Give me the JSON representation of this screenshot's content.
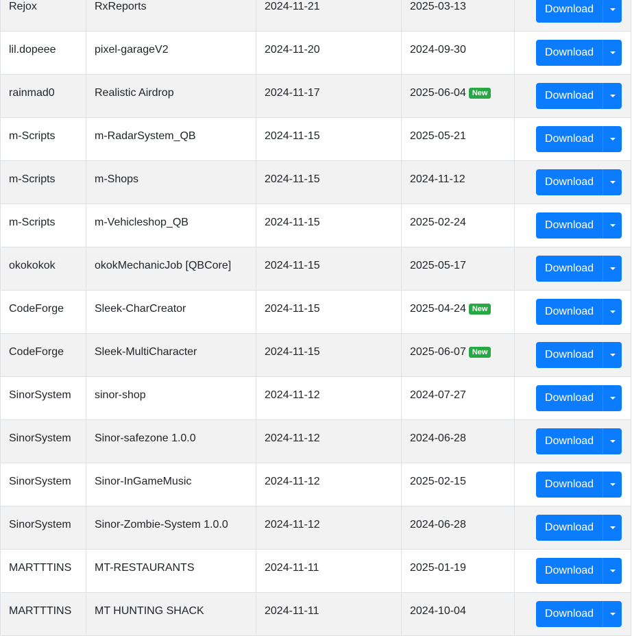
{
  "button": {
    "label": "Download"
  },
  "rows": [
    {
      "author": "Rejox",
      "name": "RxReports",
      "added": "2024-11-21",
      "updated": "2025-03-13",
      "badge": ""
    },
    {
      "author": "lil.dopeee",
      "name": "pixel-garageV2",
      "added": "2024-11-20",
      "updated": "2024-09-30",
      "badge": ""
    },
    {
      "author": "rainmad0",
      "name": "Realistic Airdrop",
      "added": "2024-11-17",
      "updated": "2025-06-04",
      "badge": "New"
    },
    {
      "author": "m-Scripts",
      "name": "m-RadarSystem_QB",
      "added": "2024-11-15",
      "updated": "2025-05-21",
      "badge": ""
    },
    {
      "author": "m-Scripts",
      "name": "m-Shops",
      "added": "2024-11-15",
      "updated": "2024-11-12",
      "badge": ""
    },
    {
      "author": "m-Scripts",
      "name": "m-Vehicleshop_QB",
      "added": "2024-11-15",
      "updated": "2025-02-24",
      "badge": ""
    },
    {
      "author": "okokokok",
      "name": "okokMechanicJob [QBCore]",
      "added": "2024-11-15",
      "updated": "2025-05-17",
      "badge": ""
    },
    {
      "author": "CodeForge",
      "name": "Sleek-CharCreator",
      "added": "2024-11-15",
      "updated": "2025-04-24",
      "badge": "New"
    },
    {
      "author": "CodeForge",
      "name": "Sleek-MultiCharacter",
      "added": "2024-11-15",
      "updated": "2025-06-07",
      "badge": "New"
    },
    {
      "author": "SinorSystem",
      "name": "sinor-shop",
      "added": "2024-11-12",
      "updated": "2024-07-27",
      "badge": ""
    },
    {
      "author": "SinorSystem",
      "name": "Sinor-safezone 1.0.0",
      "added": "2024-11-12",
      "updated": "2024-06-28",
      "badge": ""
    },
    {
      "author": "SinorSystem",
      "name": "Sinor-InGameMusic",
      "added": "2024-11-12",
      "updated": "2025-02-15",
      "badge": ""
    },
    {
      "author": "SinorSystem",
      "name": "Sinor-Zombie-System 1.0.0",
      "added": "2024-11-12",
      "updated": "2024-06-28",
      "badge": ""
    },
    {
      "author": "MARTTTINS",
      "name": "MT-RESTAURANTS",
      "added": "2024-11-11",
      "updated": "2025-01-19",
      "badge": ""
    },
    {
      "author": "MARTTTINS",
      "name": "MT HUNTING SHACK",
      "added": "2024-11-11",
      "updated": "2024-10-04",
      "badge": ""
    }
  ]
}
